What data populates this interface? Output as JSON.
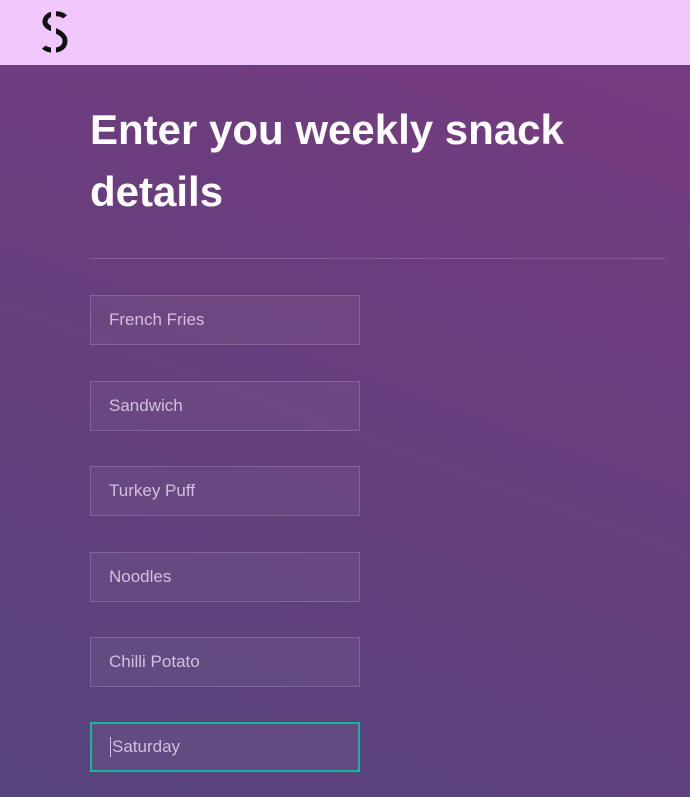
{
  "header": {
    "logo": "S",
    "logo_icon": "s-logo-icon",
    "background_color": "#f0c8fd"
  },
  "main": {
    "title": "Enter you weekly snack details",
    "fields": [
      {
        "value": "French Fries"
      },
      {
        "value": "Sandwich"
      },
      {
        "value": "Turkey Puff"
      },
      {
        "value": "Noodles"
      },
      {
        "value": "Chilli Potato"
      },
      {
        "value": "Saturday",
        "focused": true
      }
    ],
    "focus_color": "#19b59a"
  }
}
